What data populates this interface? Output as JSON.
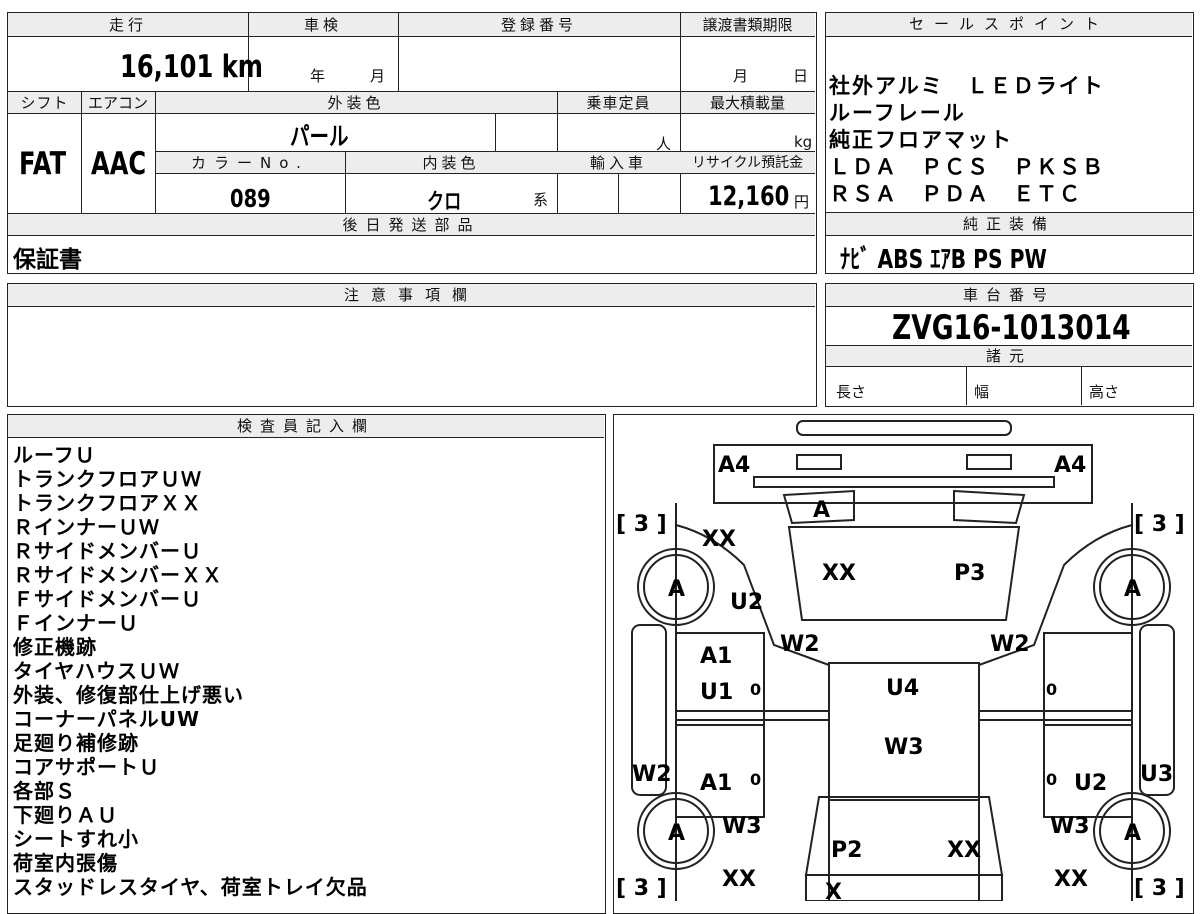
{
  "top": {
    "mileage_label": "走行",
    "mileage_value": "16,101 km",
    "shaken_label": "車検",
    "shaken_year": "年",
    "shaken_month": "月",
    "reg_label": "登録番号",
    "transfer_label": "譲渡書類期限",
    "transfer_month": "月",
    "transfer_day": "日",
    "shift_label": "シフト",
    "shift_value": "FAT",
    "aircon_label": "エアコン",
    "aircon_value": "AAC",
    "exterior_color_label": "外装色",
    "exterior_color_value": "パール",
    "capacity_label": "乗車定員",
    "capacity_unit": "人",
    "max_load_label": "最大積載量",
    "max_load_unit": "kg",
    "color_no_label": "カラーNo.",
    "color_no_value": "089",
    "interior_color_label": "内装色",
    "interior_color_value": "クロ",
    "interior_color_suffix": "系",
    "import_label": "輸入車",
    "recycle_label": "リサイクル預託金",
    "recycle_value": "12,160",
    "recycle_unit": "円",
    "later_parts_label": "後日発送部品",
    "later_parts_value": "保証書"
  },
  "sales": {
    "label": "セールスポイント",
    "lines": [
      "社外アルミ　ＬＥＤライト",
      "ルーフレール",
      "純正フロアマット",
      "ＬＤＡ　ＰＣＳ　ＰＫＳＢ",
      "ＲＳＡ　ＰＤＡ　ＥＴＣ"
    ]
  },
  "equipment": {
    "label": "純正装備",
    "value": "ﾅﾋﾞ ABS ｴｱB PS PW"
  },
  "notes": {
    "label": "注意事項欄"
  },
  "chassis": {
    "label": "車台番号",
    "value": "ZVG16-1013014",
    "spec_label": "諸元",
    "length_label": "長さ",
    "width_label": "幅",
    "height_label": "高さ"
  },
  "inspector": {
    "label": "検査員記入欄",
    "lines": [
      "ルーフＵ",
      "トランクフロアＵＷ",
      "トランクフロアＸＸ",
      "ＲインナーＵＷ",
      "ＲサイドメンバーＵ",
      "ＲサイドメンバーＸＸ",
      "ＦサイドメンバーＵ",
      "ＦインナーＵ",
      "修正機跡",
      "タイヤハウスＵＷ",
      "外装、修復部仕上げ悪い",
      "コーナーパネルUW",
      "足廻り補修跡",
      "コアサポートＵ",
      "各部Ｓ",
      "下廻りＡＵ",
      "シートすれ小",
      "荷室内張傷",
      "スタッドレスタイヤ、荷室トレイ欠品"
    ]
  },
  "diagram": {
    "labels": {
      "a4_left": "A4",
      "a4_right": "A4",
      "trunk_a": "A",
      "br_left": "[ 3 ]",
      "br_right": "[ 3 ]",
      "br_left_bottom": "[ 3 ]",
      "br_right_bottom": "[ 3 ]",
      "xx_rear_left": "XX",
      "xx_trunk": "XX",
      "p3_trunk": "P3",
      "wheel_rl": "A",
      "wheel_rr": "A",
      "wheel_fl": "A",
      "wheel_fr": "A",
      "u2_rear_left": "U2",
      "w2_left": "W2",
      "w2_right": "W2",
      "a1_left_top": "A1",
      "u1_left": "U1",
      "zero_1": "0",
      "zero_2": "0",
      "u4_roof": "U4",
      "w3_roof": "W3",
      "w2_side_left": "W2",
      "a1_left_bottom": "A1",
      "zero_3": "0",
      "zero_4": "0",
      "u2_right_bottom": "U2",
      "u3_side_right": "U3",
      "w3_front_left": "W3",
      "w3_front_right": "W3",
      "p2_hood": "P2",
      "xx_hood": "XX",
      "xx_front_left": "XX",
      "xx_front_right": "XX",
      "x_front": "X"
    }
  }
}
